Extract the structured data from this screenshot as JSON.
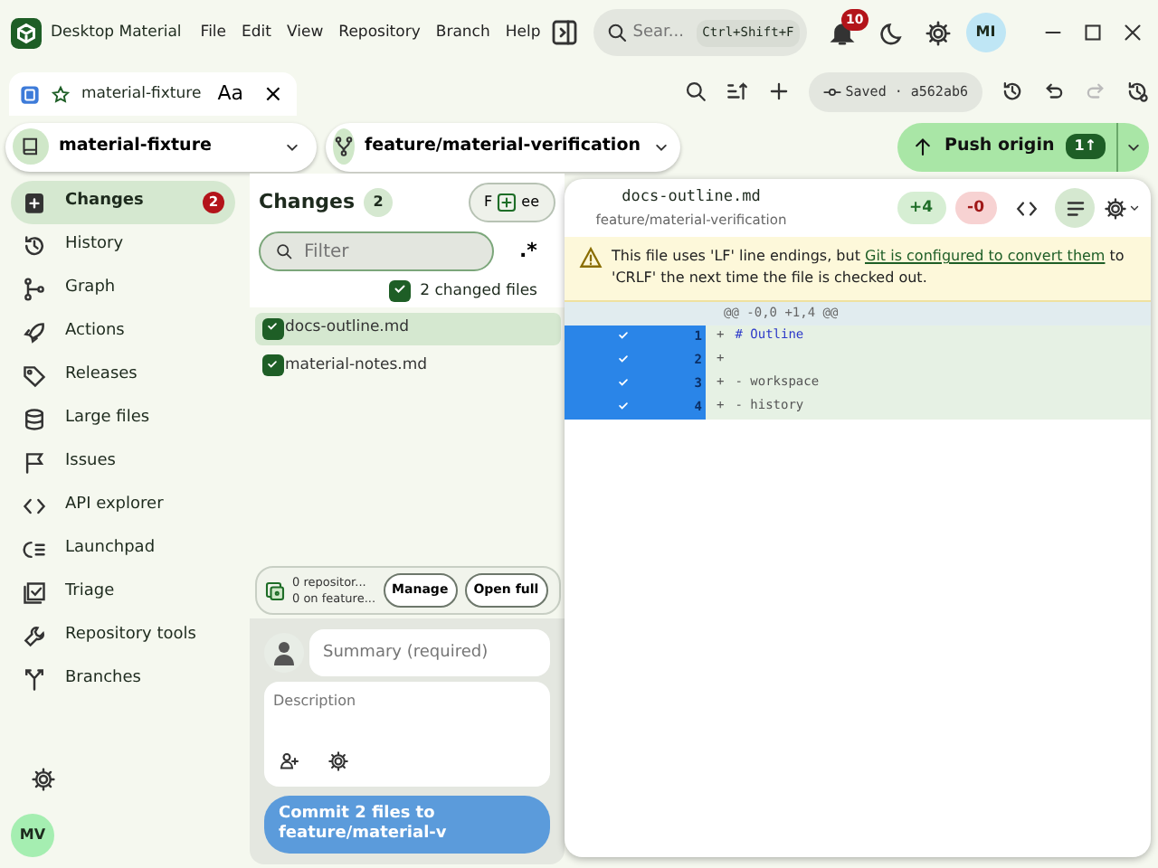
{
  "window": {
    "title": "Desktop Material",
    "menu": [
      "File",
      "Edit",
      "View",
      "Repository",
      "Branch",
      "Help"
    ],
    "search": {
      "placeholder": "Sear...",
      "shortcut": "Ctrl+Shift+F"
    },
    "notifications": "10",
    "avatar": "MI"
  },
  "tab": {
    "label": "material-fixture",
    "font_button": "Aa",
    "close": "×"
  },
  "saved": "Saved · a562ab6",
  "redo_disabled": true,
  "repository": "material-fixture",
  "branch": "feature/material-verification",
  "push": {
    "label": "Push origin",
    "badge": "1↑"
  },
  "sidebar": {
    "items": [
      {
        "label": "Changes",
        "badge": "2",
        "selected": true
      },
      {
        "label": "History",
        "selected": false
      },
      {
        "label": "Graph",
        "selected": false
      },
      {
        "label": "Actions",
        "selected": false
      },
      {
        "label": "Releases",
        "selected": false
      },
      {
        "label": "Large files",
        "selected": false
      },
      {
        "label": "Issues",
        "selected": false
      },
      {
        "label": "API explorer",
        "selected": false
      },
      {
        "label": "Launchpad",
        "selected": false
      },
      {
        "label": "Triage",
        "selected": false
      },
      {
        "label": "Repository tools",
        "selected": false
      },
      {
        "label": "Branches",
        "selected": false
      }
    ],
    "avatar": "MV"
  },
  "changes": {
    "title": "Changes",
    "count": "2",
    "pill": [
      "F",
      "ee"
    ],
    "filter": {
      "placeholder": "Filter"
    },
    "regex": ".*",
    "all": {
      "label": "2 changed files",
      "checked": true
    },
    "files": [
      {
        "name": "docs-outline.md",
        "checked": true,
        "selected": true
      },
      {
        "name": "material-notes.md",
        "checked": true,
        "selected": false
      }
    ],
    "status": {
      "lines": [
        "0 repositor...",
        "0 on feature..."
      ],
      "buttons": [
        "Manage",
        "Open full"
      ]
    },
    "summary": {
      "placeholder": "Summary (required)"
    },
    "description": {
      "placeholder": "Description"
    },
    "commit": "Commit 2 files to feature/material-v"
  },
  "diff": {
    "file": "docs-outline.md",
    "branch": "feature/material-verification",
    "added": "+4",
    "removed": "-0",
    "wrap_selected": true,
    "warning": {
      "before": "This file uses 'LF' line endings, but",
      "link": "Git is configured to convert them",
      "after": "to 'CRLF' the next time the file is checked out."
    },
    "hunk": "@@ -0,0 +1,4 @@",
    "lines": [
      {
        "number": "1",
        "marker": "+",
        "text": "# Outline",
        "kind": "heading",
        "selected": true
      },
      {
        "number": "2",
        "marker": "+",
        "kind": "plain",
        "selected": true
      },
      {
        "number": "3",
        "marker": "+",
        "text": "- workspace",
        "kind": "plain",
        "selected": true
      },
      {
        "number": "4",
        "marker": "+",
        "text": "- history",
        "kind": "plain",
        "selected": true
      }
    ]
  }
}
